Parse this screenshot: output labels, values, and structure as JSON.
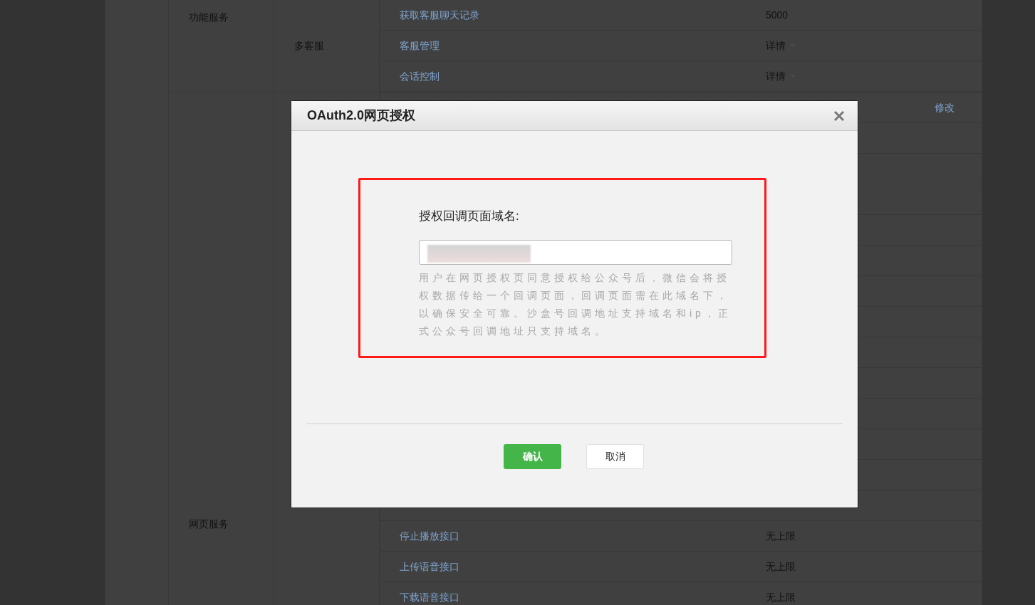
{
  "table": {
    "groups": [
      {
        "name": "功能服务",
        "subgroups": [
          {
            "name": "多客服",
            "items": [
              {
                "name": "获取客服聊天记录",
                "value": "5000",
                "kind": "text"
              },
              {
                "name": "客服管理",
                "value": "详情",
                "kind": "dropdown"
              },
              {
                "name": "会话控制",
                "value": "详情",
                "kind": "dropdown"
              }
            ]
          }
        ]
      },
      {
        "name": "网页服务",
        "subgroups": [
          {
            "items": [
              {
                "value": "修改",
                "kind": "link"
              },
              {
                "name": "停止播放接口",
                "value": "无上限",
                "kind": "text"
              },
              {
                "name": "上传语音接口",
                "value": "无上限",
                "kind": "text"
              },
              {
                "name": "下载语音接口",
                "value": "无上限",
                "kind": "text"
              }
            ]
          }
        ]
      }
    ]
  },
  "dialog": {
    "title": "OAuth2.0网页授权",
    "field_label": "授权回调页面域名:",
    "field_hint": "用户在网页授权页同意授权给公众号后，微信会将授权数据传给一个回调页面，回调页面需在此域名下，以确保安全可靠。沙盒号回调地址支持域名和ip，正式公众号回调地址只支持域名。",
    "buttons": [
      {
        "label": "确认",
        "kind": "primary"
      },
      {
        "label": "取消",
        "kind": "secondary"
      }
    ]
  }
}
